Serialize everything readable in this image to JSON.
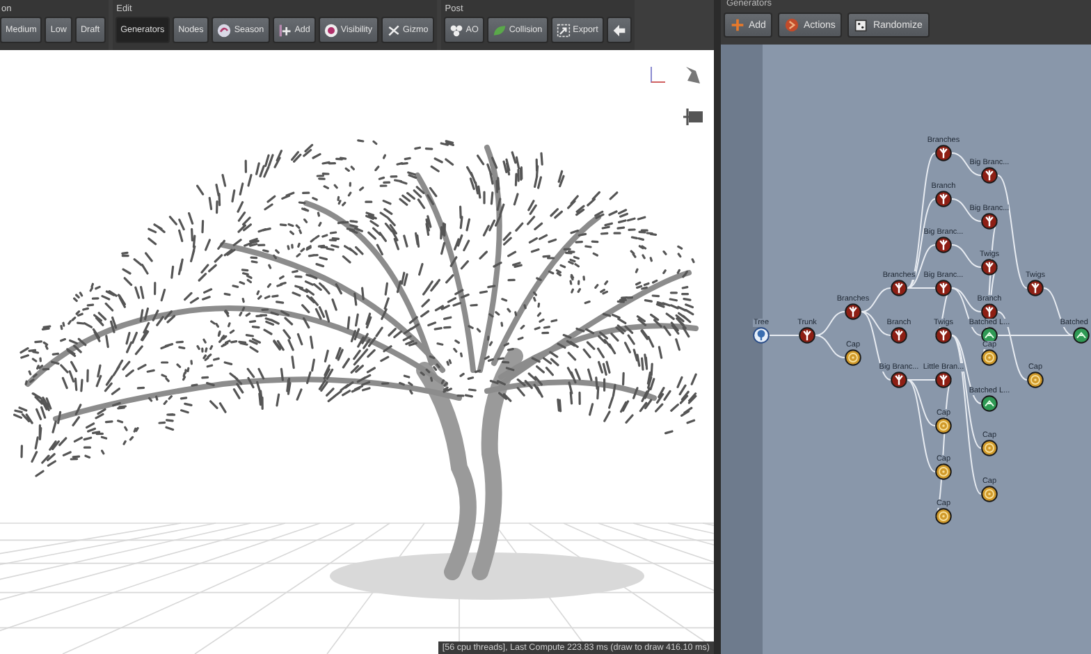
{
  "toolbar": {
    "groups": [
      {
        "label": "on",
        "buttons": [
          {
            "label": "Medium",
            "selected": false
          },
          {
            "label": "Low",
            "selected": false
          },
          {
            "label": "Draft",
            "selected": false
          }
        ]
      },
      {
        "label": "Edit",
        "buttons": [
          {
            "label": "Generators",
            "selected": true
          },
          {
            "label": "Nodes",
            "selected": false
          },
          {
            "label": "Season",
            "selected": false
          },
          {
            "label": "Add",
            "selected": false
          },
          {
            "label": "Visibility",
            "selected": false
          },
          {
            "label": "Gizmo",
            "selected": false
          }
        ]
      },
      {
        "label": "Post",
        "buttons": [
          {
            "label": "AO",
            "selected": false
          },
          {
            "label": "Collision",
            "selected": false
          },
          {
            "label": "Export",
            "selected": false
          },
          {
            "selected": false
          }
        ]
      }
    ]
  },
  "viewport": {
    "status_bar": "[56 cpu threads], Last Compute 223.83 ms (draw to draw 416.10 ms)"
  },
  "generators_panel": {
    "title": "Generators",
    "buttons": [
      {
        "label": "Add"
      },
      {
        "label": "Actions"
      },
      {
        "label": "Randomize"
      }
    ],
    "nodes": [
      {
        "label": "Branches",
        "kind": "branch"
      },
      {
        "label": "Big Branc...",
        "kind": "branch"
      },
      {
        "label": "Branch",
        "kind": "branch"
      },
      {
        "label": "Big Branc...",
        "kind": "branch"
      },
      {
        "label": "Big Branc...",
        "kind": "branch"
      },
      {
        "label": "Twigs",
        "kind": "branch"
      },
      {
        "label": "Branches",
        "kind": "branch"
      },
      {
        "label": "Big Branc...",
        "kind": "branch"
      },
      {
        "label": "Twigs",
        "kind": "branch"
      },
      {
        "label": "Branches",
        "kind": "branch"
      },
      {
        "label": "Branch",
        "kind": "branch"
      },
      {
        "label": "Tree",
        "kind": "tree"
      },
      {
        "label": "Trunk",
        "kind": "branch"
      },
      {
        "label": "Branch",
        "kind": "branch"
      },
      {
        "label": "Twigs",
        "kind": "branch"
      },
      {
        "label": "Batched L...",
        "kind": "batched"
      },
      {
        "label": "Batched",
        "kind": "batched"
      },
      {
        "label": "Cap",
        "kind": "cap"
      },
      {
        "label": "Cap",
        "kind": "cap"
      },
      {
        "label": "Big Branc...",
        "kind": "branch"
      },
      {
        "label": "Little Bran...",
        "kind": "branch"
      },
      {
        "label": "Cap",
        "kind": "cap"
      },
      {
        "label": "Batched L...",
        "kind": "batched"
      },
      {
        "label": "Cap",
        "kind": "cap"
      },
      {
        "label": "Cap",
        "kind": "cap"
      },
      {
        "label": "Cap",
        "kind": "cap"
      },
      {
        "label": "Cap",
        "kind": "cap"
      },
      {
        "label": "Cap",
        "kind": "cap"
      }
    ]
  }
}
